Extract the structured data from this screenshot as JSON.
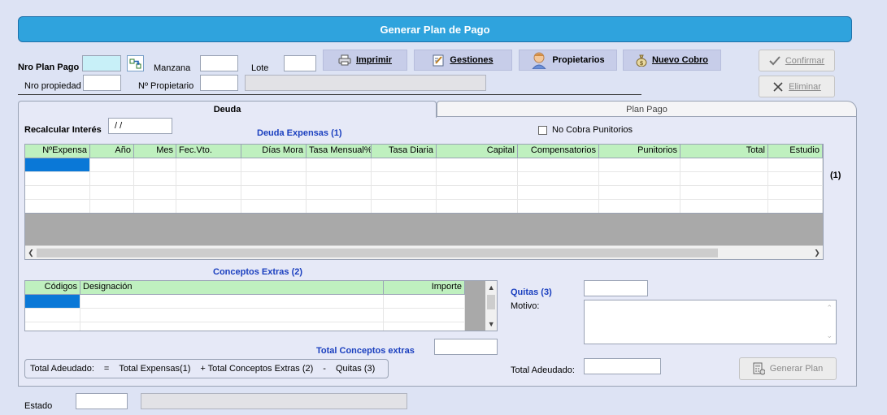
{
  "title": "Generar Plan de Pago",
  "header": {
    "nro_plan_pago_label": "Nro Plan Pago",
    "manzana_label": "Manzana",
    "lote_label": "Lote",
    "nro_propiedad_label": "Nro propiedad",
    "nro_propietario_label": "Nº Propietario",
    "nro_plan_pago_value": "",
    "manzana_value": "",
    "lote_value": "",
    "nro_propiedad_value": "",
    "nro_propietario_value": "",
    "propietario_nombre_value": ""
  },
  "toolbar": {
    "imprimir": "Imprimir",
    "gestiones": "Gestiones",
    "propietarios": "Propietarios",
    "nuevo_cobro": "Nuevo Cobro"
  },
  "side_buttons": {
    "confirmar": "Confirmar",
    "eliminar": "Eliminar"
  },
  "tabs": [
    "Deuda",
    "Plan Pago"
  ],
  "deuda": {
    "recalcular_label": "Recalcular Interés",
    "recalcular_value": " / /",
    "expensas_title": "Deuda Expensas  (1)",
    "no_cobra_label": "No Cobra Punitorios",
    "marker_1": "(1)",
    "columns": [
      "NºExpensa",
      "Año",
      "Mes",
      "Fec.Vto.",
      "Días Mora",
      "Tasa Mensual%",
      "Tasa Diaria",
      "Capital",
      "Compensatorios",
      "Punitorios",
      "Total",
      "Estudio"
    ]
  },
  "extras": {
    "title": "Conceptos Extras (2)",
    "columns": [
      "Códigos",
      "Designación",
      "Importe"
    ],
    "total_label": "Total Conceptos extras",
    "total_value": ""
  },
  "quitas": {
    "label": "Quitas (3)",
    "value": "",
    "motivo_label": "Motivo:",
    "motivo_value": ""
  },
  "summary": {
    "parts": [
      "Total Adeudado:",
      "=",
      "Total Expensas(1)",
      "+ Total Conceptos Extras (2)",
      "-",
      "Quitas (3)"
    ]
  },
  "total_adeudado": {
    "label": "Total Adeudado:",
    "value": ""
  },
  "generar_plan": "Generar Plan",
  "estado": {
    "label": "Estado",
    "code_value": "",
    "desc_value": ""
  },
  "colors": {
    "title_bar": "#2fa3dd",
    "section_title": "#1a3fbf",
    "grid_header": "#bff0bf",
    "selection": "#0a78d7"
  },
  "icons": [
    "link-icon",
    "printer-icon",
    "gestiones-icon",
    "person-icon",
    "money-bag-icon",
    "check-icon",
    "x-icon",
    "calculator-icon"
  ]
}
